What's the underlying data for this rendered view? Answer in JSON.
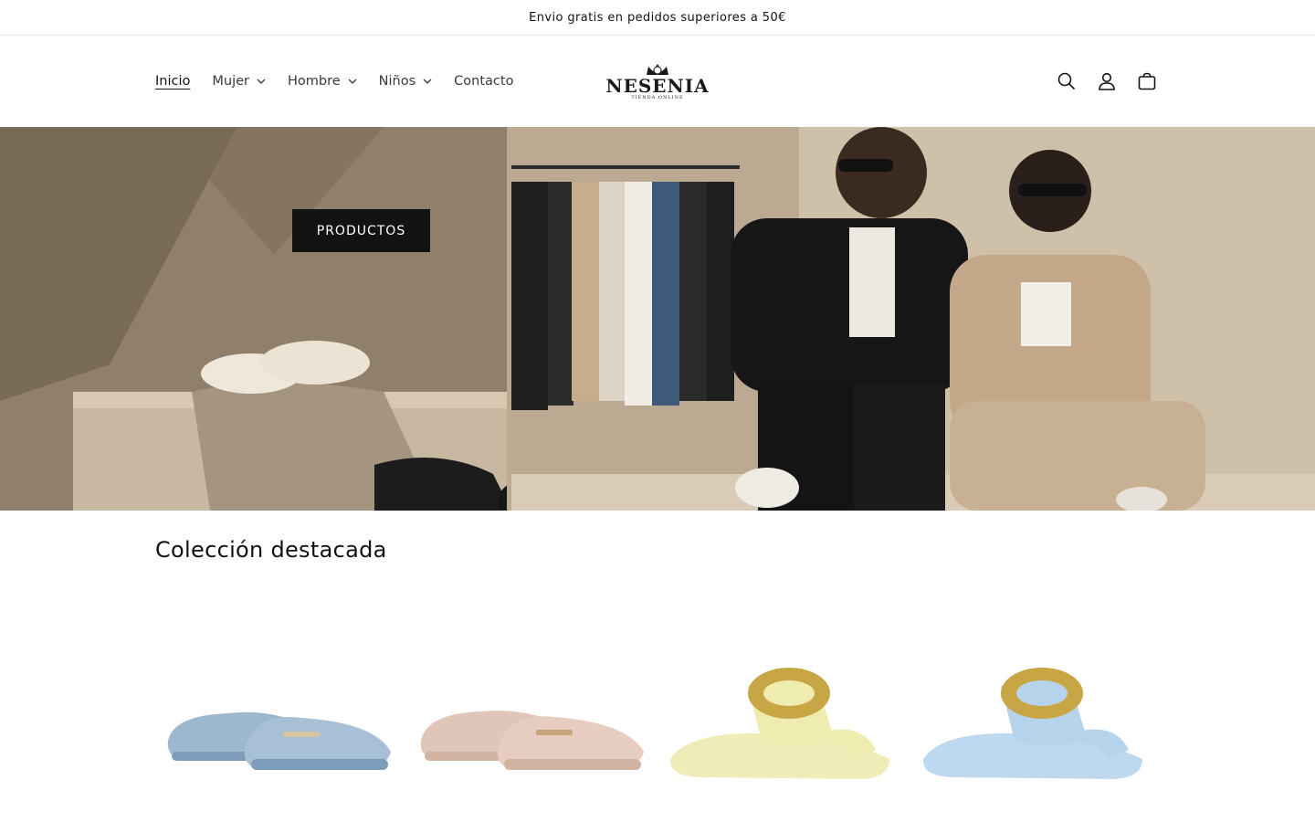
{
  "announcement": {
    "text": "Envio gratis en pedidos superiores a 50€"
  },
  "nav": {
    "items": [
      {
        "label": "Inicio",
        "active": true,
        "dropdown": false
      },
      {
        "label": "Mujer",
        "dropdown": true
      },
      {
        "label": "Hombre",
        "dropdown": true
      },
      {
        "label": "Niños",
        "dropdown": true
      },
      {
        "label": "Contacto",
        "dropdown": false
      }
    ]
  },
  "logo": {
    "word": "NESENIA",
    "sub": "TIENDA ONLINE"
  },
  "header_icons": [
    "search-icon",
    "account-icon",
    "cart-icon"
  ],
  "hero": {
    "button_label": "PRODUCTOS"
  },
  "featured": {
    "title": "Colección destacada",
    "products": [
      {
        "image": "blue-suede-loafer",
        "color": "#8fb0cc"
      },
      {
        "image": "beige-suede-loafer",
        "color": "#dcc1b2"
      },
      {
        "image": "yellow-buckle-sandal",
        "color": "#ecebb0"
      },
      {
        "image": "lightblue-buckle-sandal",
        "color": "#b7d6ec"
      }
    ]
  }
}
